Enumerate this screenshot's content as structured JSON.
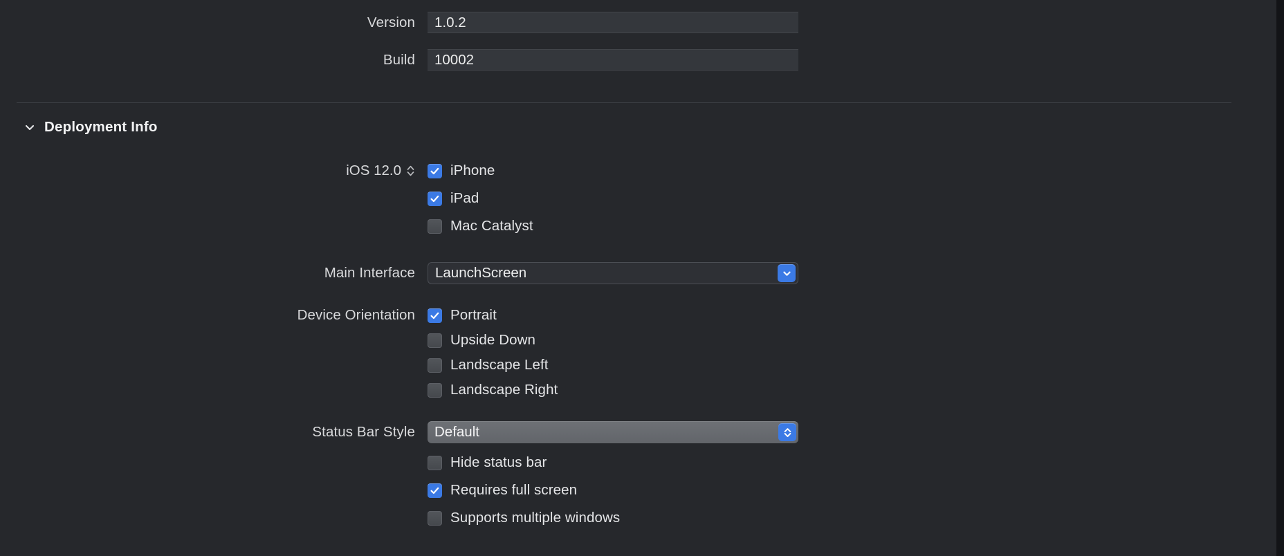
{
  "fields": {
    "version": {
      "label": "Version",
      "value": "1.0.2"
    },
    "build": {
      "label": "Build",
      "value": "10002"
    }
  },
  "section": {
    "title": "Deployment Info",
    "disclosure_icon": "chevron-down-icon",
    "expanded": true
  },
  "deployment_target": {
    "label": "iOS 12.0",
    "stepper_icon": "stepper-updown-icon",
    "devices": [
      {
        "label": "iPhone",
        "checked": true
      },
      {
        "label": "iPad",
        "checked": true
      },
      {
        "label": "Mac Catalyst",
        "checked": false
      }
    ]
  },
  "main_interface": {
    "label": "Main Interface",
    "value": "LaunchScreen",
    "button_icon": "chevron-down-icon"
  },
  "device_orientation": {
    "label": "Device Orientation",
    "items": [
      {
        "label": "Portrait",
        "checked": true
      },
      {
        "label": "Upside Down",
        "checked": false
      },
      {
        "label": "Landscape Left",
        "checked": false
      },
      {
        "label": "Landscape Right",
        "checked": false
      }
    ]
  },
  "status_bar": {
    "label": "Status Bar Style",
    "value": "Default",
    "button_icon": "chevron-updown-icon",
    "options": [
      {
        "label": "Hide status bar",
        "checked": false
      },
      {
        "label": "Requires full screen",
        "checked": true
      },
      {
        "label": "Supports multiple windows",
        "checked": false
      }
    ]
  },
  "colors": {
    "background": "#26282c",
    "accent": "#3b7ae5",
    "field_background": "#34373c",
    "popup_background": "#6a6d72",
    "text": "#e8e8ea"
  }
}
